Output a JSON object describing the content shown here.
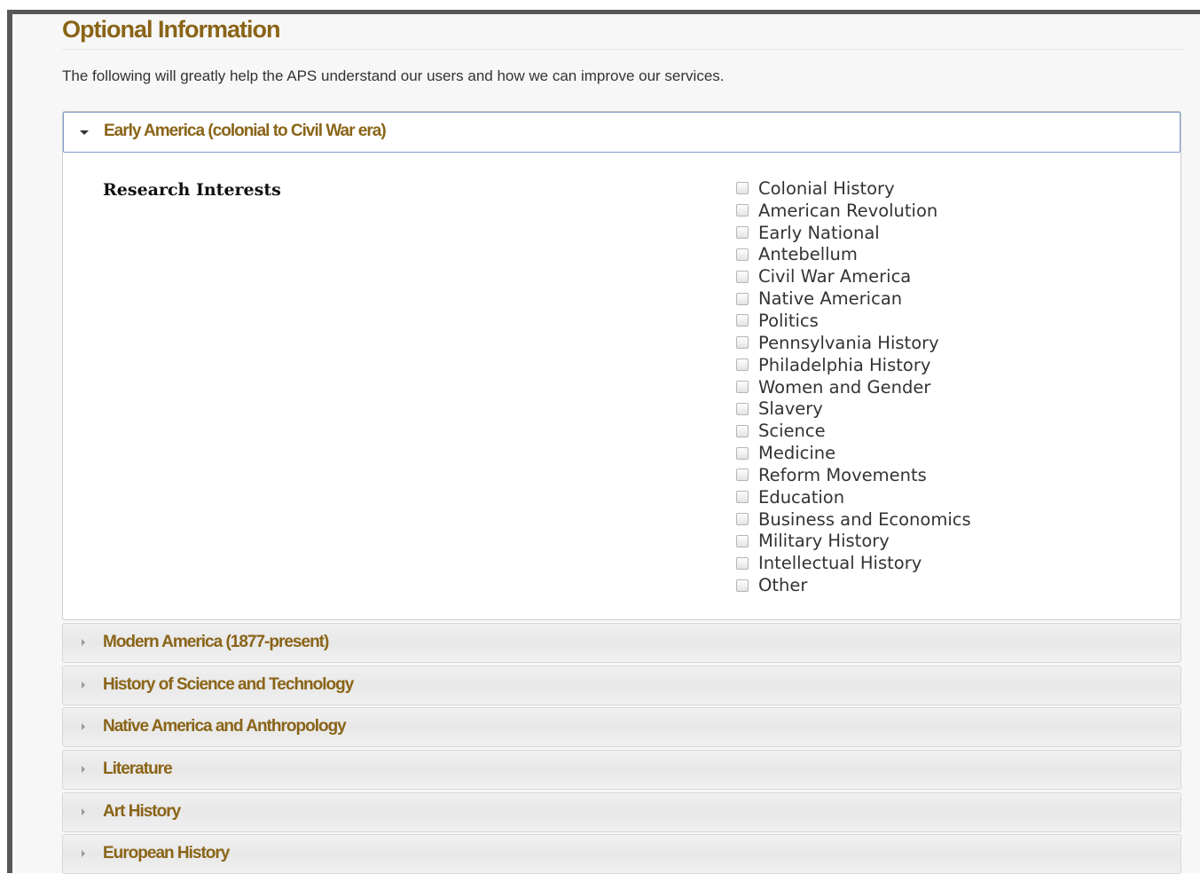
{
  "section": {
    "title": "Optional Information",
    "intro": "The following will greatly help the APS understand our users and how we can improve our services."
  },
  "accordions": [
    {
      "label": "Early America (colonial to Civil War era)",
      "expanded": true
    },
    {
      "label": "Modern America (1877-present)",
      "expanded": false
    },
    {
      "label": "History of Science and Technology",
      "expanded": false
    },
    {
      "label": "Native America and Anthropology",
      "expanded": false
    },
    {
      "label": "Literature",
      "expanded": false
    },
    {
      "label": "Art History",
      "expanded": false
    },
    {
      "label": "European History",
      "expanded": false
    }
  ],
  "research_interests": {
    "label": "Research Interests",
    "options": [
      {
        "label": "Colonial History",
        "checked": false
      },
      {
        "label": "American Revolution",
        "checked": false
      },
      {
        "label": "Early National",
        "checked": false
      },
      {
        "label": "Antebellum",
        "checked": false
      },
      {
        "label": "Civil War America",
        "checked": false
      },
      {
        "label": "Native American",
        "checked": false
      },
      {
        "label": "Politics",
        "checked": false
      },
      {
        "label": "Pennsylvania History",
        "checked": false
      },
      {
        "label": "Philadelphia History",
        "checked": false
      },
      {
        "label": "Women and Gender",
        "checked": false
      },
      {
        "label": "Slavery",
        "checked": false
      },
      {
        "label": "Science",
        "checked": false
      },
      {
        "label": "Medicine",
        "checked": false
      },
      {
        "label": "Reform Movements",
        "checked": false
      },
      {
        "label": "Education",
        "checked": false
      },
      {
        "label": "Business and Economics",
        "checked": false
      },
      {
        "label": "Military History",
        "checked": false
      },
      {
        "label": "Intellectual History",
        "checked": false
      },
      {
        "label": "Other",
        "checked": false
      }
    ]
  },
  "colors": {
    "heading_gold": "#8a6417",
    "frame_border": "#575757",
    "active_header_border": "#7f9cc9"
  },
  "icons": {
    "expanded": "caret-down-icon",
    "collapsed": "caret-right-icon"
  }
}
